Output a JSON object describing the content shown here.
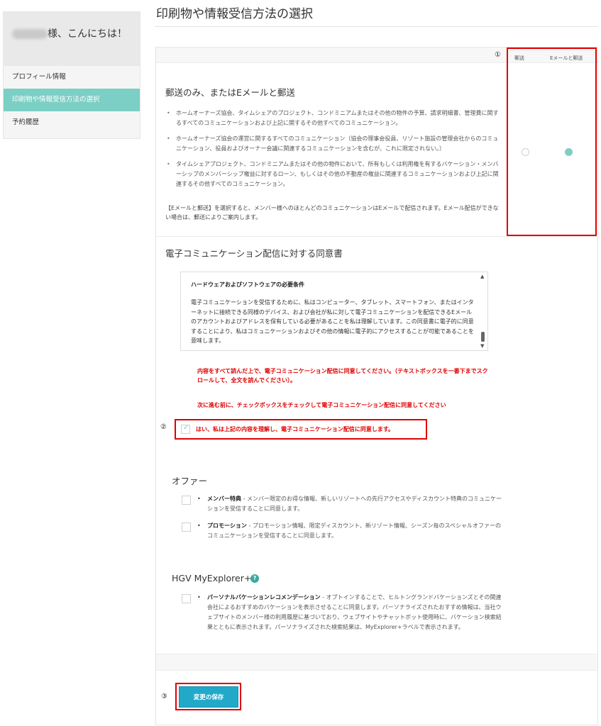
{
  "sidebar": {
    "greeting_suffix": "様、こんにちは！",
    "items": [
      {
        "label": "プロフィール情報",
        "active": false
      },
      {
        "label": "印刷物や情報受信方法の選択",
        "active": true
      },
      {
        "label": "予約履歴",
        "active": false
      }
    ]
  },
  "header": {
    "title": "印刷物や情報受信方法の選択"
  },
  "delivery": {
    "marker": "①",
    "col_mail": "郵送",
    "col_email_mail": "Eメールと郵送",
    "heading": "郵送のみ、またはEメールと郵送",
    "bullets": [
      "ホームオーナーズ協会、タイムシェアのプロジェクト、コンドミニアムまたはその他の物件の予算、請求明細書、管理費に関するすべてのコミュニケーションおよび上記に関するその他すべてのコミュニケーション。",
      "ホームオーナーズ協会の運営に関するすべてのコミュニケーション（協会の理事会役員、リゾート施設の管理会社からのコミュニケーション、役員およびオーナー会議に関連するコミュニケーションを含むが、これに限定されない。）",
      "タイムシェアプロジェクト、コンドミニアムまたはその他の物件において、所有もしくは利用権を有するバケーション・メンバーシップのメンバーシップ権益に対するローン、もしくはその他の不動産の権益に関連するコミュニケーションおよび上記に関連するその他すべてのコミュニケーション。"
    ],
    "note": "【Eメールと郵送】を選択すると、メンバー様へのほとんどのコミュニケーションはEメールで配信されます。Eメール配信ができない場合は、郵送によりご案内します。",
    "selected": "email_and_mail"
  },
  "consent": {
    "heading": "電子コミュニケーション配信に対する同意書",
    "box_title": "ハードウェアおよびソフトウェアの必要条件",
    "box_body": "電子コミュニケーションを受信するために、私はコンピューター、タブレット、スマートフォン、またはインターネットに接続できる同様のデバイス、および会社が私に対して電子コミュニケーションを配信できるEメールのアカウントおよびアドレスを保有している必要があることを私は理解しています。この同意書に電子的に同意することにより、私はコミュニケーションおよびその他の情報に電子的にアクセスすることが可能であることを意味します。",
    "warning_1": "内容をすべて読んだ上で、電子コミュニケーション配信に同意してください。（テキストボックスを一番下までスクロールして、全文を読んでください）。",
    "warning_2": "次に進む前に、チェックボックスをチェックして電子コミュニケーション配信に同意してください",
    "marker": "②",
    "checkbox_label": "はい、私は上記の内容を理解し、電子コミュニケーション配信に同意します。",
    "checked": true
  },
  "offers": {
    "heading": "オファー",
    "items": [
      {
        "title": "メンバー特典",
        "desc": " - メンバー限定のお得な情報、新しいリゾートへの先行アクセスやディスカウント特典のコミュニケーションを受信することに同意します。",
        "checked": false
      },
      {
        "title": "プロモーション",
        "desc": " - プロモーション情報、限定ディスカウント、新リゾート情報、シーズン毎のスペシャルオファーのコミュニケーションを受信することに同意します。",
        "checked": false
      }
    ]
  },
  "myexplorer": {
    "heading": "HGV MyExplorer+",
    "help_icon": "?",
    "item": {
      "title": "パーソナルバケーションレコメンデーション",
      "desc": " - オプトインすることで、ヒルトングランドバケーションズとその関連会社によるおすすめのバケーションを表示させることに同意します。パーソナライズされたおすすめ情報は、当社ウェブサイトのメンバー様の利用履歴に基づいており、ウェブサイトやチャットボット使用時に、バケーション検索結果とともに表示されます。パーソナライズされた検索結果は、MyExplorer+ラベルで表示されます。",
      "checked": false
    }
  },
  "save": {
    "marker": "③",
    "label": "変更の保存"
  },
  "colors": {
    "accent": "#7ccfc4",
    "button": "#22a9c9",
    "highlight_red": "#e00000"
  },
  "icons": [
    "checkmark-icon",
    "help-icon",
    "scroll-up-icon",
    "scroll-down-icon"
  ]
}
